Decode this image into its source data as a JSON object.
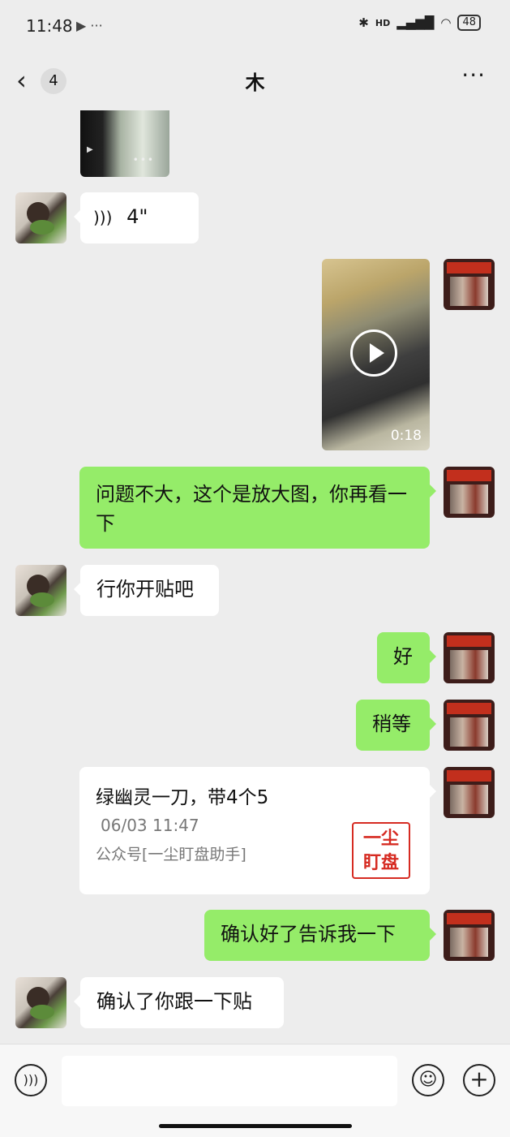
{
  "status_bar": {
    "time": "11:48",
    "extra": "▶ ···",
    "network": "HD",
    "battery": "48"
  },
  "header": {
    "back_symbol": "‹",
    "unread_count": "4",
    "title": "木",
    "more_symbol": "···"
  },
  "messages": [
    {
      "type": "video",
      "sender": "them"
    },
    {
      "type": "voice",
      "sender": "them",
      "text": "4\""
    },
    {
      "type": "video",
      "sender": "me",
      "duration": "0:18"
    },
    {
      "type": "text",
      "sender": "me",
      "text": "问题不大，这个是放大图，你再看一下"
    },
    {
      "type": "text",
      "sender": "them",
      "text": "行你开贴吧"
    },
    {
      "type": "text",
      "sender": "me",
      "text": "好"
    },
    {
      "type": "text",
      "sender": "me",
      "text": "稍等"
    },
    {
      "type": "card",
      "sender": "me",
      "title": "绿幽灵一刀，带4个5",
      "time": "06/03 11:47",
      "source": "公众号[一尘盯盘助手]",
      "logo_line1": "一尘",
      "logo_line2": "盯盘"
    },
    {
      "type": "text",
      "sender": "me",
      "text": "确认好了告诉我一下"
    },
    {
      "type": "text",
      "sender": "them",
      "text": "确认了你跟一下贴"
    }
  ],
  "input_bar": {
    "voice_icon": "voice-icon",
    "emoji_icon": "emoji-icon",
    "plus_icon": "plus-icon",
    "text": ""
  }
}
